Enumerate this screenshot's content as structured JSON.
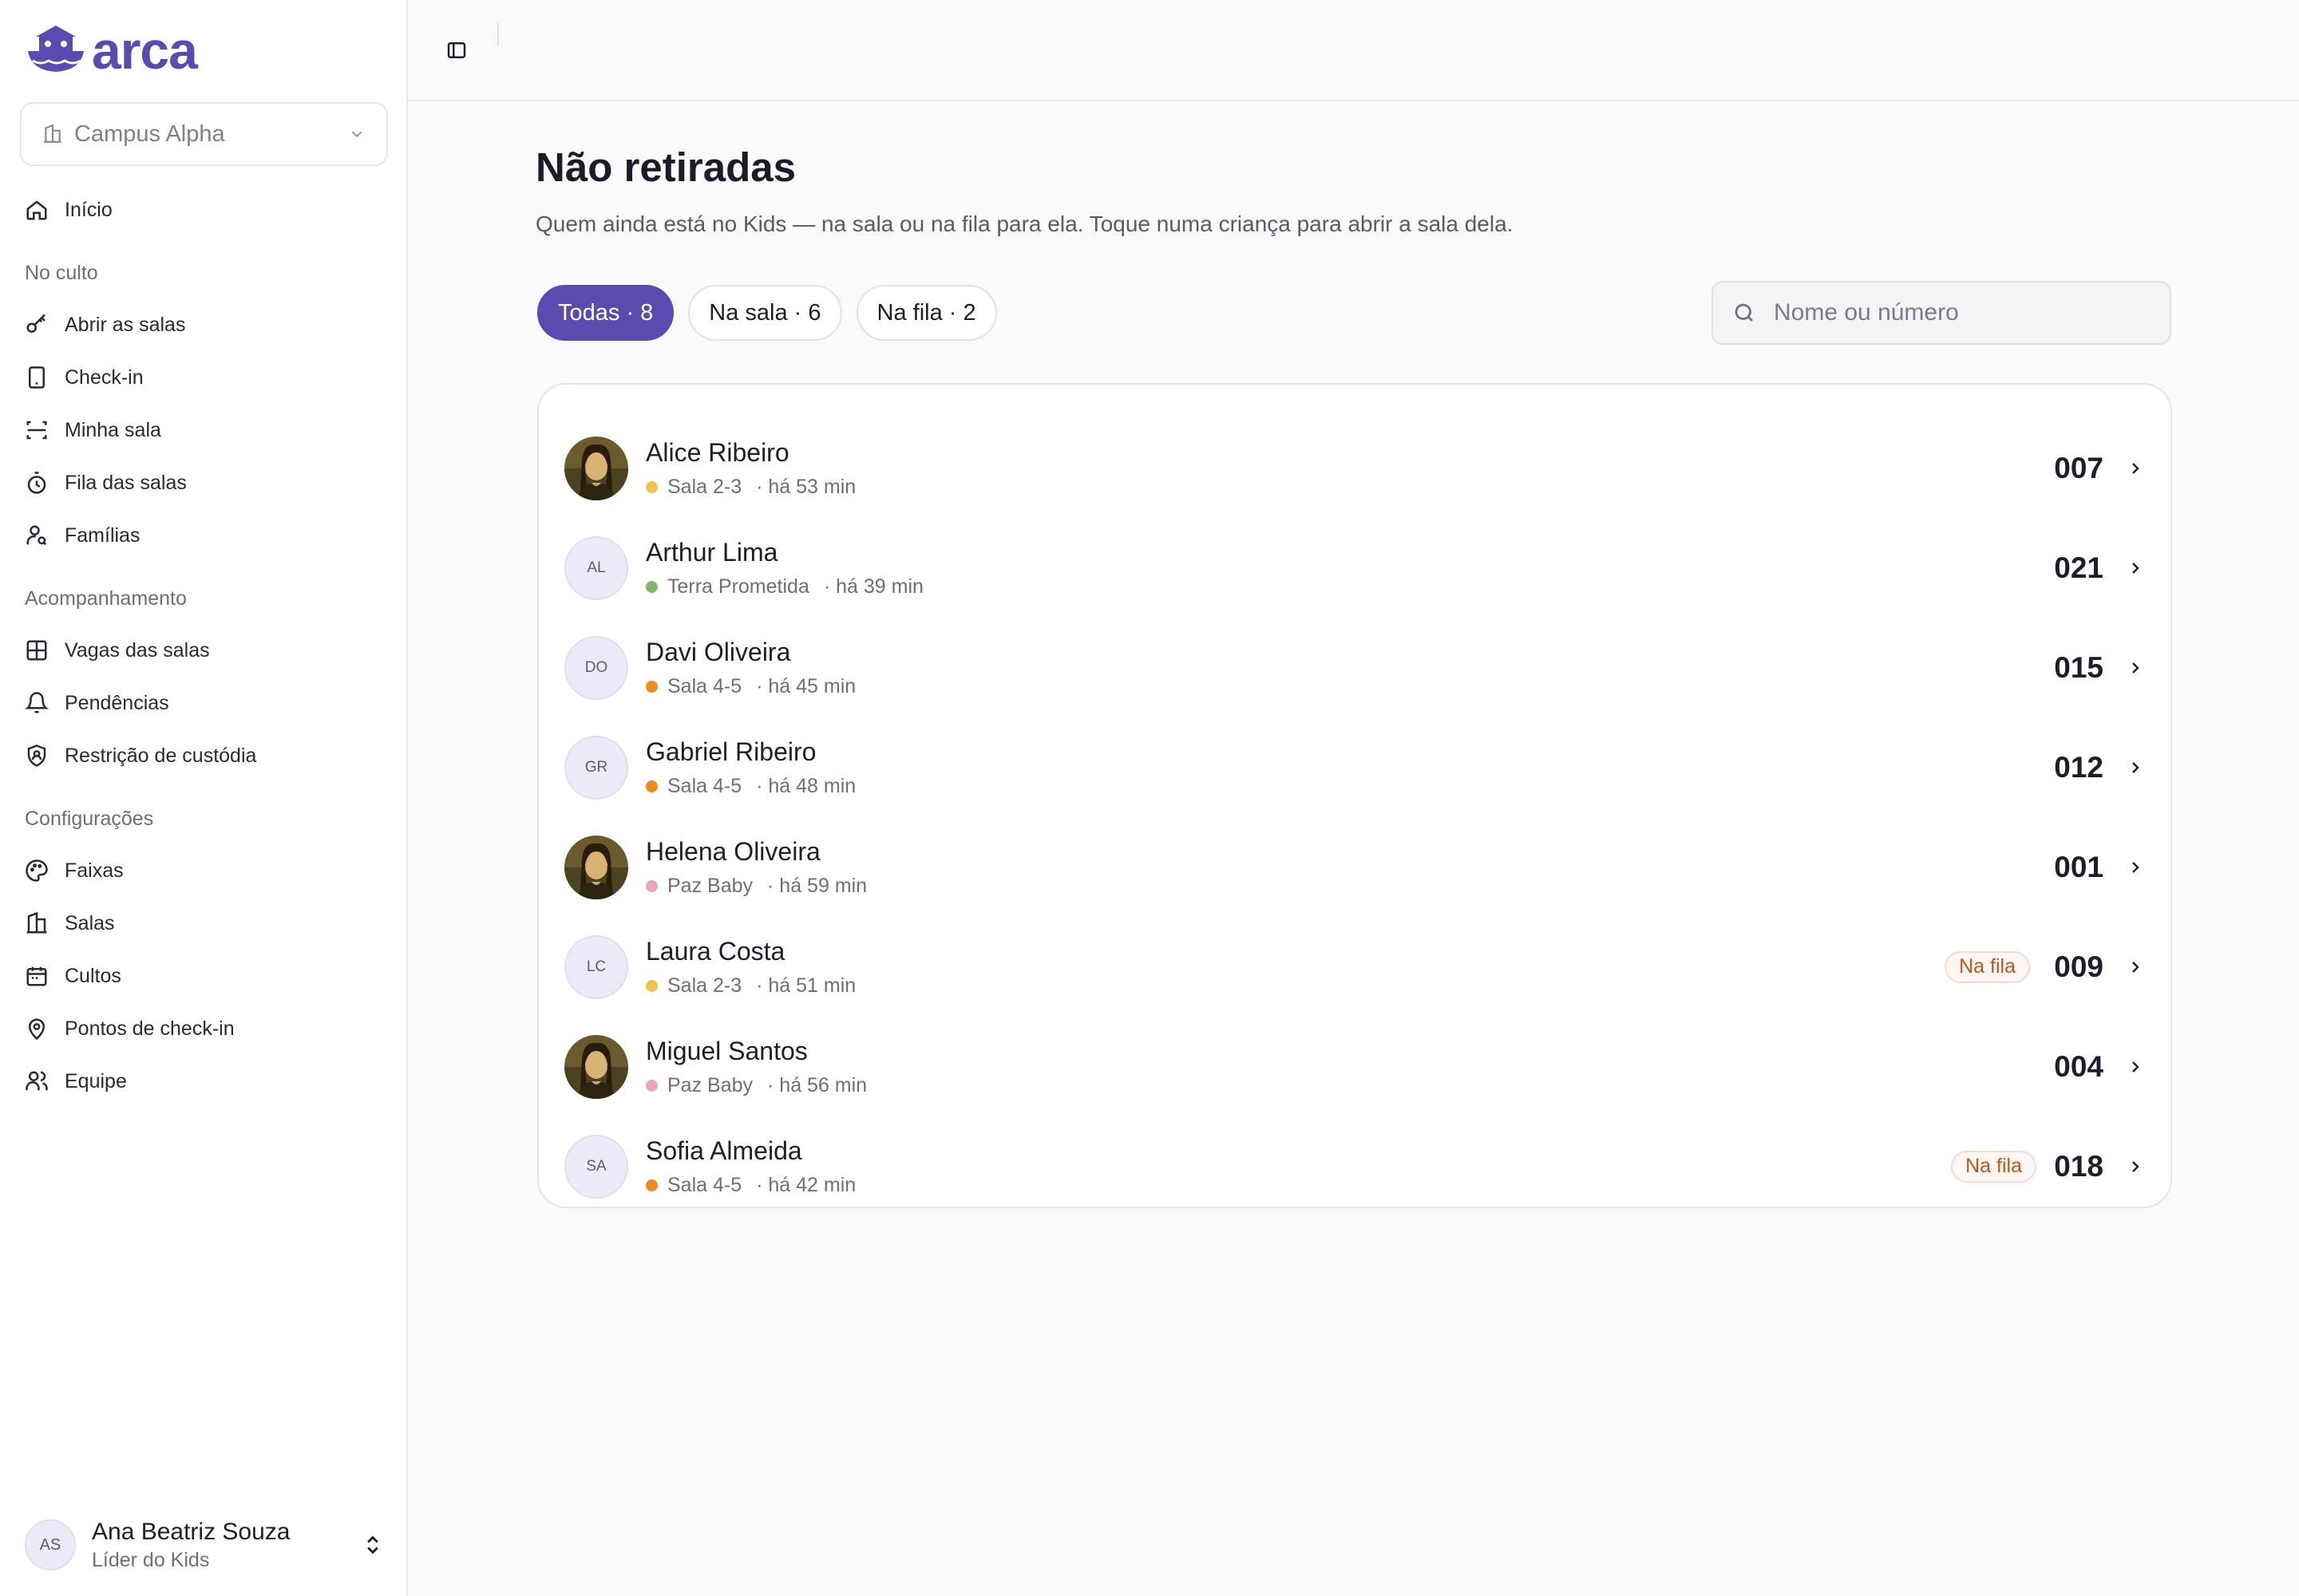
{
  "logo": {
    "text": "arca"
  },
  "campus": {
    "label": "Campus Alpha"
  },
  "nav": {
    "inicio": "Início",
    "section_culto": "No culto",
    "abrir_salas": "Abrir as salas",
    "checkin": "Check-in",
    "minha_sala": "Minha sala",
    "fila_salas": "Fila das salas",
    "familias": "Famílias",
    "section_acomp": "Acompanhamento",
    "vagas_salas": "Vagas das salas",
    "pendencias": "Pendências",
    "restricao": "Restrição de custódia",
    "section_config": "Configurações",
    "faixas": "Faixas",
    "salas": "Salas",
    "cultos": "Cultos",
    "pontos": "Pontos de check-in",
    "equipe": "Equipe"
  },
  "user": {
    "initials": "AS",
    "name": "Ana Beatriz Souza",
    "role": "Líder do Kids"
  },
  "page": {
    "title": "Não retiradas",
    "subtitle": "Quem ainda está no Kids — na sala ou na fila para ela. Toque numa criança para abrir a sala dela."
  },
  "tabs": {
    "all": "Todas · 8",
    "room": "Na sala · 6",
    "queue": "Na fila · 2"
  },
  "search": {
    "placeholder": "Nome ou número"
  },
  "colors": {
    "accent": "#5b4ab0",
    "sala23": "#f2c14e",
    "terra": "#7fb86a",
    "sala45": "#ef8a1f",
    "pazbaby": "#f0a3b8"
  },
  "children": [
    {
      "name": "Alice Ribeiro",
      "initials": "",
      "photo": true,
      "room": "Sala 2-3",
      "dot": "#f2c14e",
      "time": "· há 53 min",
      "number": "007",
      "badge": ""
    },
    {
      "name": "Arthur Lima",
      "initials": "AL",
      "photo": false,
      "room": "Terra Prometida",
      "dot": "#7fb86a",
      "time": "· há 39 min",
      "number": "021",
      "badge": ""
    },
    {
      "name": "Davi Oliveira",
      "initials": "DO",
      "photo": false,
      "room": "Sala 4-5",
      "dot": "#ef8a1f",
      "time": "· há 45 min",
      "number": "015",
      "badge": ""
    },
    {
      "name": "Gabriel Ribeiro",
      "initials": "GR",
      "photo": false,
      "room": "Sala 4-5",
      "dot": "#ef8a1f",
      "time": "· há 48 min",
      "number": "012",
      "badge": ""
    },
    {
      "name": "Helena Oliveira",
      "initials": "",
      "photo": true,
      "room": "Paz Baby",
      "dot": "#f0a3b8",
      "time": "· há 59 min",
      "number": "001",
      "badge": ""
    },
    {
      "name": "Laura Costa",
      "initials": "LC",
      "photo": false,
      "room": "Sala 2-3",
      "dot": "#f2c14e",
      "time": "· há 51 min",
      "number": "009",
      "badge": "Na fila"
    },
    {
      "name": "Miguel Santos",
      "initials": "",
      "photo": true,
      "room": "Paz Baby",
      "dot": "#f0a3b8",
      "time": "· há 56 min",
      "number": "004",
      "badge": ""
    },
    {
      "name": "Sofia Almeida",
      "initials": "SA",
      "photo": false,
      "room": "Sala 4-5",
      "dot": "#ef8a1f",
      "time": "· há 42 min",
      "number": "018",
      "badge": "Na fila"
    }
  ]
}
